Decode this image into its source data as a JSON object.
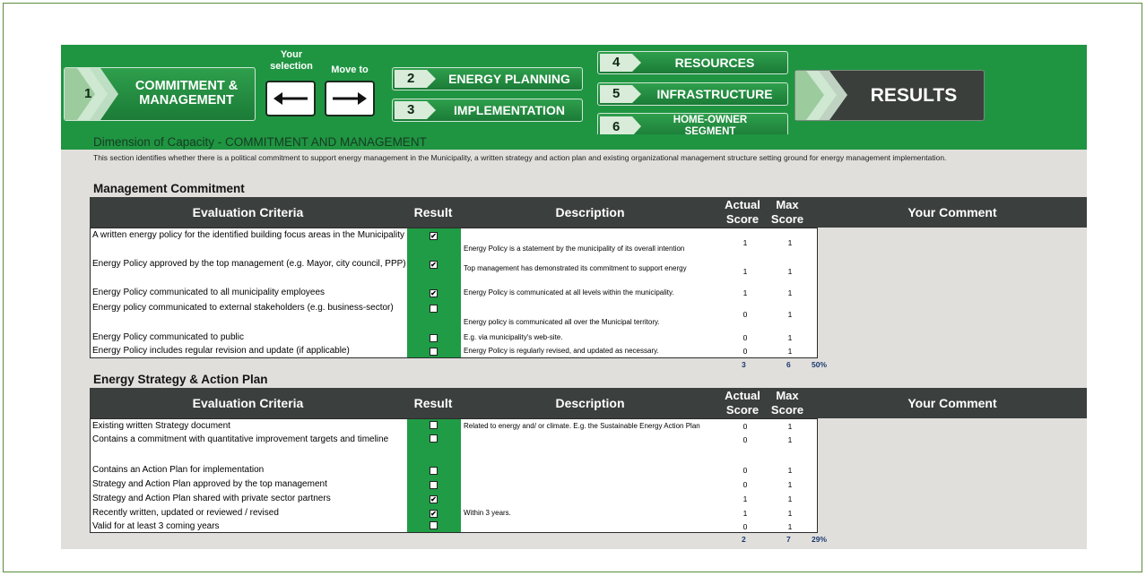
{
  "nav": {
    "step1": {
      "num": "1",
      "label_line1": "COMMITMENT &",
      "label_line2": "MANAGEMENT"
    },
    "your_selection_line1": "Your",
    "your_selection_line2": "selection",
    "move_to": "Move to",
    "step2": {
      "num": "2",
      "label": "ENERGY PLANNING"
    },
    "step3": {
      "num": "3",
      "label": "IMPLEMENTATION"
    },
    "step4": {
      "num": "4",
      "label": "RESOURCES"
    },
    "step5": {
      "num": "5",
      "label": "INFRASTRUCTURE"
    },
    "step6": {
      "num": "6",
      "label_line1": "HOME-OWNER",
      "label_line2": "SEGMENT"
    },
    "results": "RESULTS"
  },
  "dimension_title": "Dimension of Capacity - COMMITMENT AND MANAGEMENT",
  "intro_text": "This section identifies whether there is a political commitment to support energy management in the Municipality, a written strategy and action plan and existing organizational management structure setting ground for energy management implementation.",
  "headers": {
    "criteria": "Evaluation Criteria",
    "result": "Result",
    "description": "Description",
    "actual_line1": "Actual",
    "actual_line2": "Score",
    "max_line1": "Max",
    "max_line2": "Score",
    "comment": "Your Comment"
  },
  "section1": {
    "title": "Management Commitment",
    "rows": [
      {
        "criteria": "A written energy policy for the identified building focus areas in the Municipality",
        "checked": "✔",
        "description": "Energy Policy is a statement by the municipality of its overall intention",
        "actual": "1",
        "max": "1"
      },
      {
        "criteria": "Energy Policy approved by the top management (e.g. Mayor, city council, PPP)",
        "checked": "✔",
        "description": "Top management has demonstrated its commitment to support energy",
        "actual": "1",
        "max": "1"
      },
      {
        "criteria": "Energy Policy communicated to all municipality employees",
        "checked": "✔",
        "description": "Energy Policy is communicated at all levels within the municipality.",
        "actual": "1",
        "max": "1"
      },
      {
        "criteria": "Energy policy communicated to external stakeholders (e.g. business-sector)",
        "checked": "",
        "description": "Energy policy is communicated all over the Municipal territory.",
        "actual": "0",
        "max": "1"
      },
      {
        "criteria": "Energy Policy communicated to public",
        "checked": "",
        "description": "E.g. via municipality's web-site.",
        "actual": "0",
        "max": "1"
      },
      {
        "criteria": "Energy Policy includes regular revision and update (if applicable)",
        "checked": "",
        "description": "Energy Policy is regularly revised, and updated as necessary.",
        "actual": "0",
        "max": "1"
      }
    ],
    "total_actual": "3",
    "total_max": "6",
    "percent": "50%"
  },
  "section2": {
    "title": "Energy Strategy & Action Plan",
    "rows": [
      {
        "criteria": "Existing written Strategy document",
        "checked": "",
        "description": "Related to energy and/ or climate. E.g. the Sustainable Energy Action Plan",
        "actual": "0",
        "max": "1"
      },
      {
        "criteria": "Contains a commitment with quantitative improvement targets and timeline",
        "checked": "",
        "description": "",
        "actual": "0",
        "max": "1"
      },
      {
        "criteria": "Contains an Action Plan for implementation",
        "checked": "",
        "description": "",
        "actual": "0",
        "max": "1"
      },
      {
        "criteria": "Strategy and Action Plan approved by the top management",
        "checked": "",
        "description": "",
        "actual": "0",
        "max": "1"
      },
      {
        "criteria": "Strategy and Action Plan shared with private sector partners",
        "checked": "✔",
        "description": "",
        "actual": "1",
        "max": "1"
      },
      {
        "criteria": "Recently written, updated or reviewed / revised",
        "checked": "✔",
        "description": "Within 3 years.",
        "actual": "1",
        "max": "1"
      },
      {
        "criteria": "Valid for at least 3 coming years",
        "checked": "",
        "description": "",
        "actual": "0",
        "max": "1"
      }
    ],
    "total_actual": "2",
    "total_max": "7",
    "percent": "29%"
  }
}
